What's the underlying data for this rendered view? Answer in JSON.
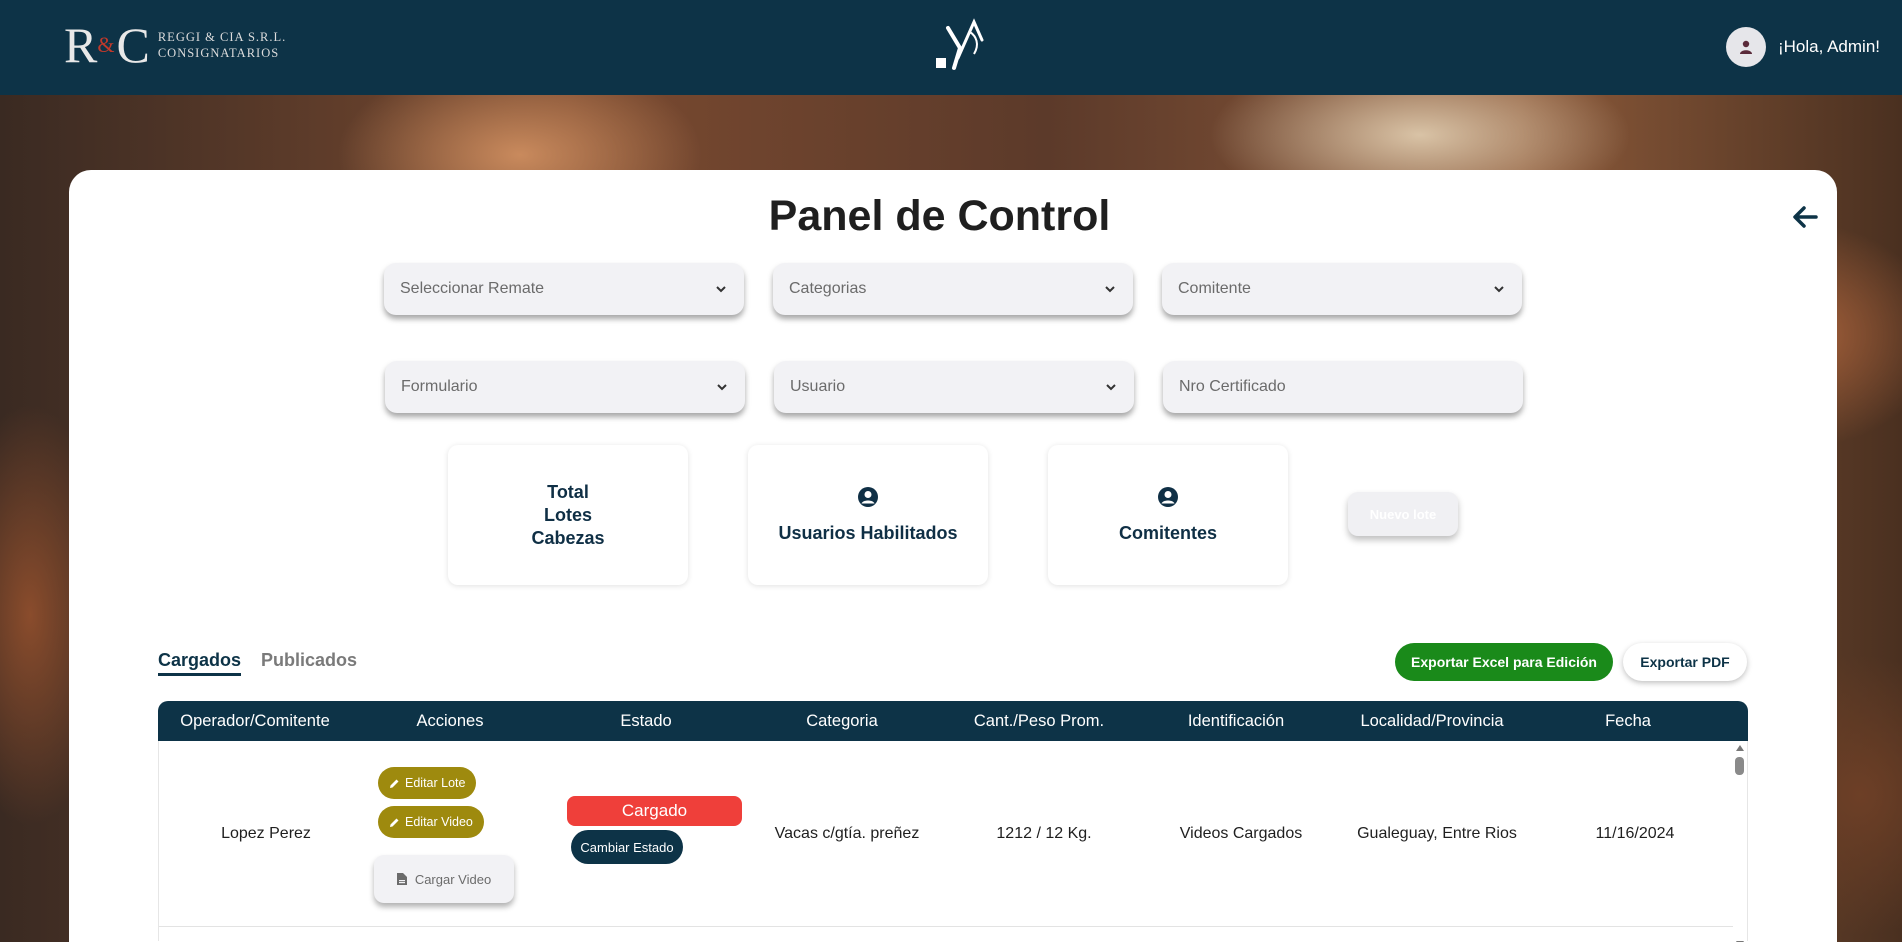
{
  "header": {
    "brand_mark_r": "R",
    "brand_mark_amp": "&",
    "brand_mark_c": "C",
    "brand_line1": "REGGI & CIA S.R.L.",
    "brand_line2": "CONSIGNATARIOS",
    "greeting": "¡Hola, Admin!",
    "icons": {
      "center_logo": "brand-y-logo",
      "avatar": "user-avatar-icon"
    }
  },
  "page": {
    "title": "Panel de Control",
    "back_icon": "arrow-left-icon"
  },
  "filters": {
    "row1": [
      {
        "placeholder": "Seleccionar Remate"
      },
      {
        "placeholder": "Categorias"
      },
      {
        "placeholder": "Comitente"
      }
    ],
    "row2": [
      {
        "placeholder": "Formulario"
      },
      {
        "placeholder": "Usuario"
      }
    ],
    "certificado_placeholder": "Nro Certificado"
  },
  "stats": {
    "total": {
      "line1": "Total",
      "line2": "Lotes",
      "line3": "Cabezas"
    },
    "usuarios": {
      "label": "Usuarios Habilitados",
      "icon": "user-circle-icon"
    },
    "comitentes": {
      "label": "Comitentes",
      "icon": "user-circle-icon"
    },
    "nuevo_lote": "Nuevo lote"
  },
  "tabs": [
    {
      "label": "Cargados",
      "active": true
    },
    {
      "label": "Publicados",
      "active": false
    }
  ],
  "actions": {
    "export_excel": "Exportar Excel para Edición",
    "export_pdf": "Exportar PDF"
  },
  "table": {
    "columns": [
      "Operador/Comitente",
      "Acciones",
      "Estado",
      "Categoria",
      "Cant./Peso Prom.",
      "Identificación",
      "Localidad/Provincia",
      "Fecha"
    ],
    "rows": [
      {
        "operador": "Lopez Perez",
        "acciones": {
          "editar_lote": "Editar Lote",
          "editar_video": "Editar Video",
          "cargar_video": "Cargar Video"
        },
        "estado": "Cargado",
        "cambiar_estado": "Cambiar Estado",
        "categoria": "Vacas c/gtía. preñez",
        "cant_peso": "1212 / 12 Kg.",
        "identificacion": "Videos Cargados",
        "localidad": "Gualeguay, Entre Rios",
        "fecha": "11/16/2024"
      }
    ]
  },
  "colors": {
    "navy": "#0d3347",
    "olive": "#9e8a0e",
    "estado_red": "#ef3f3a",
    "excel_green": "#1a8a1a"
  }
}
